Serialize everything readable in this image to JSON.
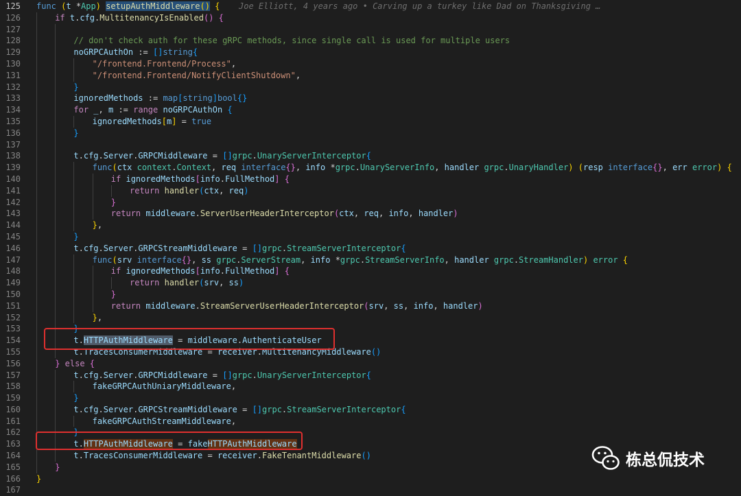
{
  "blame": "Joe Elliott, 4 years ago • Carving up a turkey like Dad on Thanksgiving …",
  "watermark": "栋总侃技术",
  "lines": [
    {
      "n": "125",
      "g": [],
      "t": [
        [
          "kw",
          "func "
        ],
        [
          "b1",
          "("
        ],
        [
          "va",
          "t "
        ],
        [
          "op",
          "*"
        ],
        [
          "ty",
          "App"
        ],
        [
          "b1",
          ")"
        ],
        [
          "op",
          " "
        ],
        [
          "fn hl-sel",
          "setupAuthMiddleware"
        ],
        [
          "b1 hl-sel",
          "()"
        ],
        [
          "op",
          " "
        ],
        [
          "b1",
          "{"
        ]
      ]
    },
    {
      "n": "126",
      "g": [
        0
      ],
      "t": [
        [
          "ctl",
          "if "
        ],
        [
          "va",
          "t"
        ],
        [
          "op",
          "."
        ],
        [
          "va",
          "cfg"
        ],
        [
          "op",
          "."
        ],
        [
          "fn",
          "MultitenancyIsEnabled"
        ],
        [
          "b2",
          "()"
        ],
        [
          "op",
          " "
        ],
        [
          "b2",
          "{"
        ]
      ]
    },
    {
      "n": "127",
      "g": [
        0,
        1
      ],
      "t": []
    },
    {
      "n": "128",
      "g": [
        0,
        1
      ],
      "t": [
        [
          "cm",
          "// don't check auth for these gRPC methods, since single call is used for multiple users"
        ]
      ]
    },
    {
      "n": "129",
      "g": [
        0,
        1
      ],
      "t": [
        [
          "va",
          "noGRPCAuthOn"
        ],
        [
          "op",
          " := "
        ],
        [
          "b3",
          "[]"
        ],
        [
          "kw",
          "string"
        ],
        [
          "b3",
          "{"
        ]
      ]
    },
    {
      "n": "130",
      "g": [
        0,
        1,
        2
      ],
      "t": [
        [
          "st",
          "\"/frontend.Frontend/Process\""
        ],
        [
          "op",
          ","
        ]
      ]
    },
    {
      "n": "131",
      "g": [
        0,
        1,
        2
      ],
      "t": [
        [
          "st",
          "\"/frontend.Frontend/NotifyClientShutdown\""
        ],
        [
          "op",
          ","
        ]
      ]
    },
    {
      "n": "132",
      "g": [
        0,
        1
      ],
      "t": [
        [
          "b3",
          "}"
        ]
      ]
    },
    {
      "n": "133",
      "g": [
        0,
        1
      ],
      "t": [
        [
          "va",
          "ignoredMethods"
        ],
        [
          "op",
          " := "
        ],
        [
          "kw",
          "map"
        ],
        [
          "b3",
          "["
        ],
        [
          "kw",
          "string"
        ],
        [
          "b3",
          "]"
        ],
        [
          "kw",
          "bool"
        ],
        [
          "b3",
          "{}"
        ]
      ]
    },
    {
      "n": "134",
      "g": [
        0,
        1
      ],
      "t": [
        [
          "ctl",
          "for "
        ],
        [
          "va",
          "_"
        ],
        [
          "op",
          ", "
        ],
        [
          "va",
          "m"
        ],
        [
          "op",
          " := "
        ],
        [
          "ctl",
          "range "
        ],
        [
          "va",
          "noGRPCAuthOn"
        ],
        [
          "op",
          " "
        ],
        [
          "b3",
          "{"
        ]
      ]
    },
    {
      "n": "135",
      "g": [
        0,
        1,
        2
      ],
      "t": [
        [
          "va",
          "ignoredMethods"
        ],
        [
          "b1",
          "["
        ],
        [
          "va",
          "m"
        ],
        [
          "b1",
          "]"
        ],
        [
          "op",
          " = "
        ],
        [
          "kw",
          "true"
        ]
      ]
    },
    {
      "n": "136",
      "g": [
        0,
        1
      ],
      "t": [
        [
          "b3",
          "}"
        ]
      ]
    },
    {
      "n": "137",
      "g": [
        0,
        1
      ],
      "t": []
    },
    {
      "n": "138",
      "g": [
        0,
        1
      ],
      "t": [
        [
          "va",
          "t"
        ],
        [
          "op",
          "."
        ],
        [
          "va",
          "cfg"
        ],
        [
          "op",
          "."
        ],
        [
          "va",
          "Server"
        ],
        [
          "op",
          "."
        ],
        [
          "va",
          "GRPCMiddleware"
        ],
        [
          "op",
          " = "
        ],
        [
          "b3",
          "[]"
        ],
        [
          "ty",
          "grpc"
        ],
        [
          "op",
          "."
        ],
        [
          "ty",
          "UnaryServerInterceptor"
        ],
        [
          "b3",
          "{"
        ]
      ]
    },
    {
      "n": "139",
      "g": [
        0,
        1,
        2
      ],
      "t": [
        [
          "kw",
          "func"
        ],
        [
          "b1",
          "("
        ],
        [
          "va",
          "ctx "
        ],
        [
          "ty",
          "context"
        ],
        [
          "op",
          "."
        ],
        [
          "ty",
          "Context"
        ],
        [
          "op",
          ", "
        ],
        [
          "va",
          "req "
        ],
        [
          "kw",
          "interface"
        ],
        [
          "b2",
          "{}"
        ],
        [
          "op",
          ", "
        ],
        [
          "va",
          "info "
        ],
        [
          "op",
          "*"
        ],
        [
          "ty",
          "grpc"
        ],
        [
          "op",
          "."
        ],
        [
          "ty",
          "UnaryServerInfo"
        ],
        [
          "op",
          ", "
        ],
        [
          "va",
          "handler "
        ],
        [
          "ty",
          "grpc"
        ],
        [
          "op",
          "."
        ],
        [
          "ty",
          "UnaryHandler"
        ],
        [
          "b1",
          ")"
        ],
        [
          "op",
          " "
        ],
        [
          "b1",
          "("
        ],
        [
          "va",
          "resp "
        ],
        [
          "kw",
          "interface"
        ],
        [
          "b2",
          "{}"
        ],
        [
          "op",
          ", "
        ],
        [
          "va",
          "err "
        ],
        [
          "ty",
          "error"
        ],
        [
          "b1",
          ")"
        ],
        [
          "op",
          " "
        ],
        [
          "b1",
          "{"
        ]
      ]
    },
    {
      "n": "140",
      "g": [
        0,
        1,
        2,
        3
      ],
      "t": [
        [
          "ctl",
          "if "
        ],
        [
          "va",
          "ignoredMethods"
        ],
        [
          "b2",
          "["
        ],
        [
          "va",
          "info"
        ],
        [
          "op",
          "."
        ],
        [
          "va",
          "FullMethod"
        ],
        [
          "b2",
          "]"
        ],
        [
          "op",
          " "
        ],
        [
          "b2",
          "{"
        ]
      ]
    },
    {
      "n": "141",
      "g": [
        0,
        1,
        2,
        3,
        4
      ],
      "t": [
        [
          "ctl",
          "return "
        ],
        [
          "fn",
          "handler"
        ],
        [
          "b3",
          "("
        ],
        [
          "va",
          "ctx"
        ],
        [
          "op",
          ", "
        ],
        [
          "va",
          "req"
        ],
        [
          "b3",
          ")"
        ]
      ]
    },
    {
      "n": "142",
      "g": [
        0,
        1,
        2,
        3
      ],
      "t": [
        [
          "b2",
          "}"
        ]
      ]
    },
    {
      "n": "143",
      "g": [
        0,
        1,
        2,
        3
      ],
      "t": [
        [
          "ctl",
          "return "
        ],
        [
          "va",
          "middleware"
        ],
        [
          "op",
          "."
        ],
        [
          "fn",
          "ServerUserHeaderInterceptor"
        ],
        [
          "b2",
          "("
        ],
        [
          "va",
          "ctx"
        ],
        [
          "op",
          ", "
        ],
        [
          "va",
          "req"
        ],
        [
          "op",
          ", "
        ],
        [
          "va",
          "info"
        ],
        [
          "op",
          ", "
        ],
        [
          "va",
          "handler"
        ],
        [
          "b2",
          ")"
        ]
      ]
    },
    {
      "n": "144",
      "g": [
        0,
        1,
        2
      ],
      "t": [
        [
          "b1",
          "}"
        ],
        [
          "op",
          ","
        ]
      ]
    },
    {
      "n": "145",
      "g": [
        0,
        1
      ],
      "t": [
        [
          "b3",
          "}"
        ]
      ]
    },
    {
      "n": "146",
      "g": [
        0,
        1
      ],
      "t": [
        [
          "va",
          "t"
        ],
        [
          "op",
          "."
        ],
        [
          "va",
          "cfg"
        ],
        [
          "op",
          "."
        ],
        [
          "va",
          "Server"
        ],
        [
          "op",
          "."
        ],
        [
          "va",
          "GRPCStreamMiddleware"
        ],
        [
          "op",
          " = "
        ],
        [
          "b3",
          "[]"
        ],
        [
          "ty",
          "grpc"
        ],
        [
          "op",
          "."
        ],
        [
          "ty",
          "StreamServerInterceptor"
        ],
        [
          "b3",
          "{"
        ]
      ]
    },
    {
      "n": "147",
      "g": [
        0,
        1,
        2
      ],
      "t": [
        [
          "kw",
          "func"
        ],
        [
          "b1",
          "("
        ],
        [
          "va",
          "srv "
        ],
        [
          "kw",
          "interface"
        ],
        [
          "b2",
          "{}"
        ],
        [
          "op",
          ", "
        ],
        [
          "va",
          "ss "
        ],
        [
          "ty",
          "grpc"
        ],
        [
          "op",
          "."
        ],
        [
          "ty",
          "ServerStream"
        ],
        [
          "op",
          ", "
        ],
        [
          "va",
          "info "
        ],
        [
          "op",
          "*"
        ],
        [
          "ty",
          "grpc"
        ],
        [
          "op",
          "."
        ],
        [
          "ty",
          "StreamServerInfo"
        ],
        [
          "op",
          ", "
        ],
        [
          "va",
          "handler "
        ],
        [
          "ty",
          "grpc"
        ],
        [
          "op",
          "."
        ],
        [
          "ty",
          "StreamHandler"
        ],
        [
          "b1",
          ")"
        ],
        [
          "op",
          " "
        ],
        [
          "ty",
          "error"
        ],
        [
          "op",
          " "
        ],
        [
          "b1",
          "{"
        ]
      ]
    },
    {
      "n": "148",
      "g": [
        0,
        1,
        2,
        3
      ],
      "t": [
        [
          "ctl",
          "if "
        ],
        [
          "va",
          "ignoredMethods"
        ],
        [
          "b2",
          "["
        ],
        [
          "va",
          "info"
        ],
        [
          "op",
          "."
        ],
        [
          "va",
          "FullMethod"
        ],
        [
          "b2",
          "]"
        ],
        [
          "op",
          " "
        ],
        [
          "b2",
          "{"
        ]
      ]
    },
    {
      "n": "149",
      "g": [
        0,
        1,
        2,
        3,
        4
      ],
      "t": [
        [
          "ctl",
          "return "
        ],
        [
          "fn",
          "handler"
        ],
        [
          "b3",
          "("
        ],
        [
          "va",
          "srv"
        ],
        [
          "op",
          ", "
        ],
        [
          "va",
          "ss"
        ],
        [
          "b3",
          ")"
        ]
      ]
    },
    {
      "n": "150",
      "g": [
        0,
        1,
        2,
        3
      ],
      "t": [
        [
          "b2",
          "}"
        ]
      ]
    },
    {
      "n": "151",
      "g": [
        0,
        1,
        2,
        3
      ],
      "t": [
        [
          "ctl",
          "return "
        ],
        [
          "va",
          "middleware"
        ],
        [
          "op",
          "."
        ],
        [
          "fn",
          "StreamServerUserHeaderInterceptor"
        ],
        [
          "b2",
          "("
        ],
        [
          "va",
          "srv"
        ],
        [
          "op",
          ", "
        ],
        [
          "va",
          "ss"
        ],
        [
          "op",
          ", "
        ],
        [
          "va",
          "info"
        ],
        [
          "op",
          ", "
        ],
        [
          "va",
          "handler"
        ],
        [
          "b2",
          ")"
        ]
      ]
    },
    {
      "n": "152",
      "g": [
        0,
        1,
        2
      ],
      "t": [
        [
          "b1",
          "}"
        ],
        [
          "op",
          ","
        ]
      ]
    },
    {
      "n": "153",
      "g": [
        0,
        1
      ],
      "t": [
        [
          "b3",
          "}"
        ]
      ]
    },
    {
      "n": "154",
      "g": [
        0,
        1
      ],
      "t": [
        [
          "va",
          "t"
        ],
        [
          "op",
          "."
        ],
        [
          "va hl-word",
          "HTTPAuthMiddleware"
        ],
        [
          "op",
          " = "
        ],
        [
          "va",
          "middleware"
        ],
        [
          "op",
          "."
        ],
        [
          "va",
          "AuthenticateUser"
        ]
      ]
    },
    {
      "n": "155",
      "g": [
        0,
        1
      ],
      "t": [
        [
          "va",
          "t"
        ],
        [
          "op",
          "."
        ],
        [
          "va",
          "TracesConsumerMiddleware"
        ],
        [
          "op",
          " = "
        ],
        [
          "va",
          "receiver"
        ],
        [
          "op",
          "."
        ],
        [
          "va",
          "MultitenancyMiddleware"
        ],
        [
          "b3",
          "()"
        ]
      ]
    },
    {
      "n": "156",
      "g": [
        0
      ],
      "t": [
        [
          "b2",
          "}"
        ],
        [
          "op",
          " "
        ],
        [
          "ctl",
          "else"
        ],
        [
          "op",
          " "
        ],
        [
          "b2",
          "{"
        ]
      ]
    },
    {
      "n": "157",
      "g": [
        0,
        1
      ],
      "t": [
        [
          "va",
          "t"
        ],
        [
          "op",
          "."
        ],
        [
          "va",
          "cfg"
        ],
        [
          "op",
          "."
        ],
        [
          "va",
          "Server"
        ],
        [
          "op",
          "."
        ],
        [
          "va",
          "GRPCMiddleware"
        ],
        [
          "op",
          " = "
        ],
        [
          "b3",
          "[]"
        ],
        [
          "ty",
          "grpc"
        ],
        [
          "op",
          "."
        ],
        [
          "ty",
          "UnaryServerInterceptor"
        ],
        [
          "b3",
          "{"
        ]
      ]
    },
    {
      "n": "158",
      "g": [
        0,
        1,
        2
      ],
      "t": [
        [
          "va",
          "fakeGRPCAuthUniaryMiddleware"
        ],
        [
          "op",
          ","
        ]
      ]
    },
    {
      "n": "159",
      "g": [
        0,
        1
      ],
      "t": [
        [
          "b3",
          "}"
        ]
      ]
    },
    {
      "n": "160",
      "g": [
        0,
        1
      ],
      "t": [
        [
          "va",
          "t"
        ],
        [
          "op",
          "."
        ],
        [
          "va",
          "cfg"
        ],
        [
          "op",
          "."
        ],
        [
          "va",
          "Server"
        ],
        [
          "op",
          "."
        ],
        [
          "va",
          "GRPCStreamMiddleware"
        ],
        [
          "op",
          " = "
        ],
        [
          "b3",
          "[]"
        ],
        [
          "ty",
          "grpc"
        ],
        [
          "op",
          "."
        ],
        [
          "ty",
          "StreamServerInterceptor"
        ],
        [
          "b3",
          "{"
        ]
      ]
    },
    {
      "n": "161",
      "g": [
        0,
        1,
        2
      ],
      "t": [
        [
          "va",
          "fakeGRPCAuthStreamMiddleware"
        ],
        [
          "op",
          ","
        ]
      ]
    },
    {
      "n": "162",
      "g": [
        0,
        1
      ],
      "t": [
        [
          "b3",
          "}"
        ]
      ]
    },
    {
      "n": "163",
      "g": [
        0,
        1
      ],
      "t": [
        [
          "va",
          "t"
        ],
        [
          "op",
          "."
        ],
        [
          "va hl-find",
          "HTTPAuthMiddleware"
        ],
        [
          "op",
          " = "
        ],
        [
          "va",
          "fake"
        ],
        [
          "va hl-find",
          "HTTPAuthMiddleware"
        ]
      ]
    },
    {
      "n": "164",
      "g": [
        0,
        1
      ],
      "t": [
        [
          "va",
          "t"
        ],
        [
          "op",
          "."
        ],
        [
          "va",
          "TracesConsumerMiddleware"
        ],
        [
          "op",
          " = "
        ],
        [
          "va",
          "receiver"
        ],
        [
          "op",
          "."
        ],
        [
          "fn",
          "FakeTenantMiddleware"
        ],
        [
          "b3",
          "()"
        ]
      ]
    },
    {
      "n": "165",
      "g": [
        0
      ],
      "t": [
        [
          "b2",
          "}"
        ]
      ]
    },
    {
      "n": "166",
      "g": [],
      "t": [
        [
          "b1",
          "}"
        ]
      ]
    },
    {
      "n": "167",
      "g": [],
      "t": []
    }
  ]
}
